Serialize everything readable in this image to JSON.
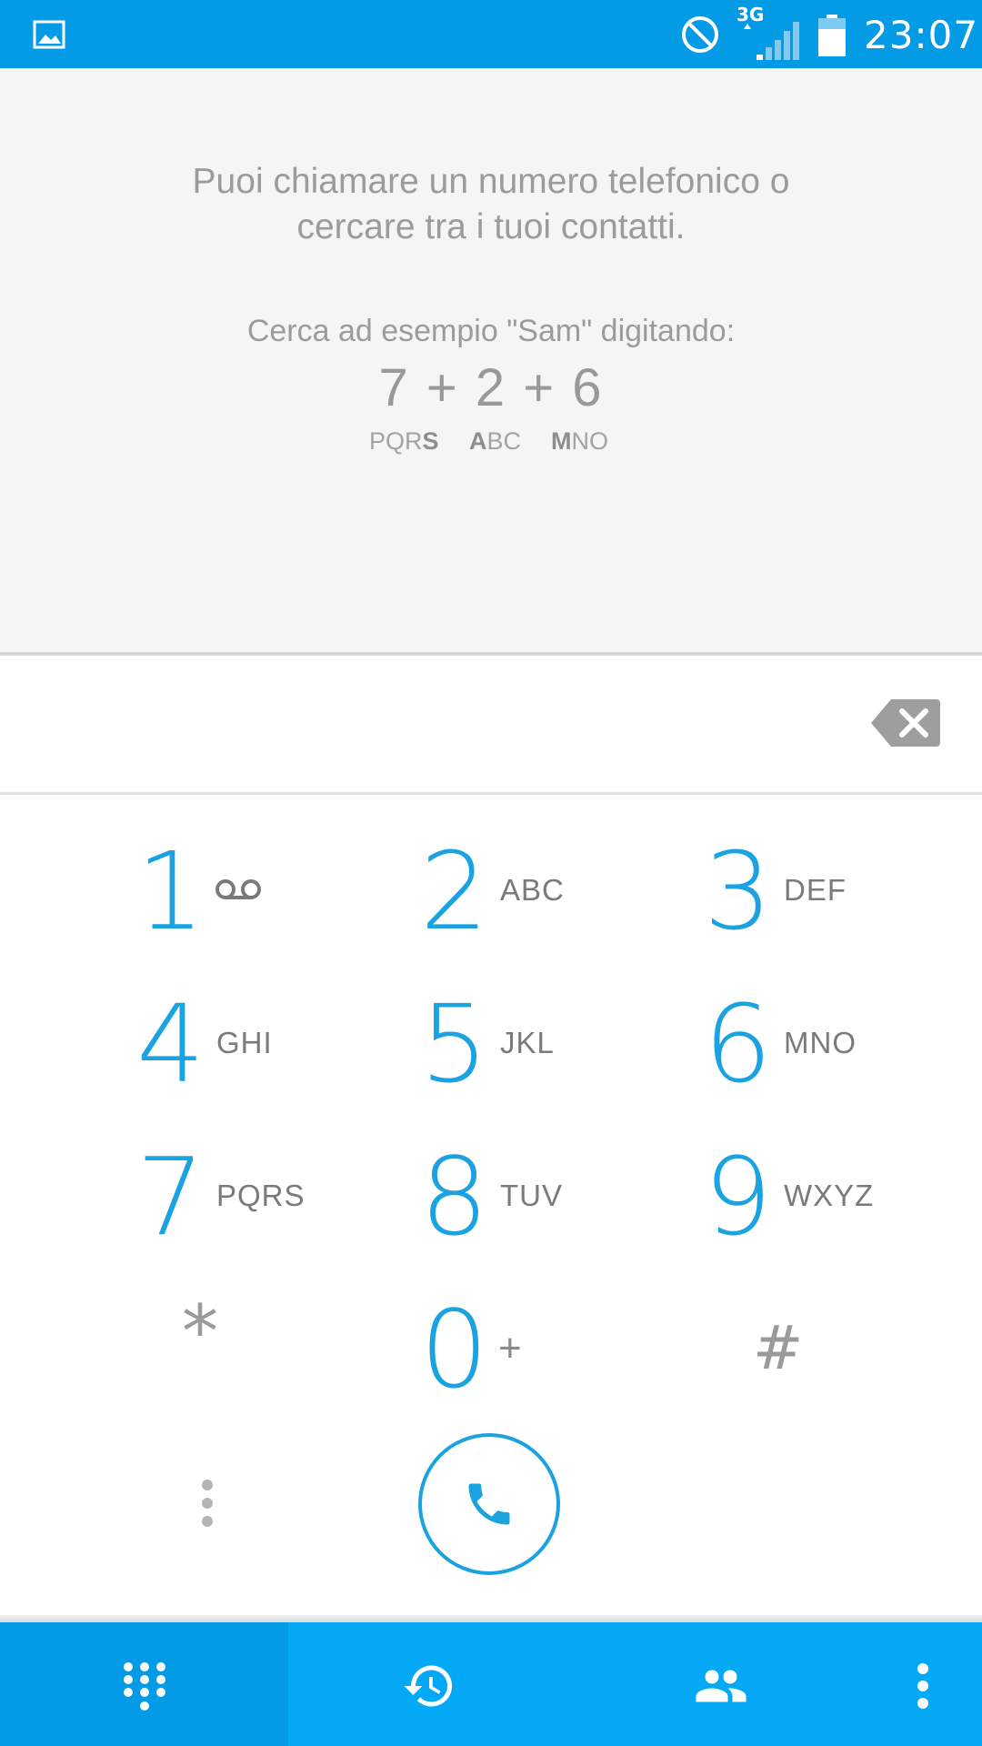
{
  "status_bar": {
    "network": "3G",
    "time": "23:07",
    "icons": [
      "gallery-icon",
      "no-disturb-icon",
      "signal-icon",
      "battery-icon"
    ]
  },
  "hint": {
    "line1": "Puoi chiamare un numero telefonico o",
    "line2": "cercare tra i tuoi contatti.",
    "example": "Cerca ad esempio \"Sam\" digitando:",
    "digits": "7  + 2 + 6",
    "letters": [
      {
        "plain": "PQR",
        "bold": "S",
        "suffix": ""
      },
      {
        "plain": "",
        "bold": "A",
        "suffix": "BC"
      },
      {
        "plain": "",
        "bold": "M",
        "suffix": "NO"
      }
    ]
  },
  "input": {
    "value": "",
    "placeholder": ""
  },
  "keypad": {
    "keys": [
      {
        "digit": "1",
        "letters": ""
      },
      {
        "digit": "2",
        "letters": "ABC"
      },
      {
        "digit": "3",
        "letters": "DEF"
      },
      {
        "digit": "4",
        "letters": "GHI"
      },
      {
        "digit": "5",
        "letters": "JKL"
      },
      {
        "digit": "6",
        "letters": "MNO"
      },
      {
        "digit": "7",
        "letters": "PQRS"
      },
      {
        "digit": "8",
        "letters": "TUV"
      },
      {
        "digit": "9",
        "letters": "WXYZ"
      },
      {
        "digit": "0",
        "letters": "+"
      }
    ],
    "star": "*",
    "hash": "#"
  },
  "colors": {
    "accent": "#1aa3e0",
    "status_bar": "#039be5",
    "tab_bar": "#03a9f4",
    "hint_bg": "#f5f5f5"
  },
  "tabs": [
    {
      "name": "dialpad",
      "icon": "dialpad-icon",
      "active": true
    },
    {
      "name": "history",
      "icon": "history-icon",
      "active": false
    },
    {
      "name": "contacts",
      "icon": "contacts-icon",
      "active": false
    },
    {
      "name": "overflow",
      "icon": "overflow-menu-icon",
      "active": false
    }
  ]
}
